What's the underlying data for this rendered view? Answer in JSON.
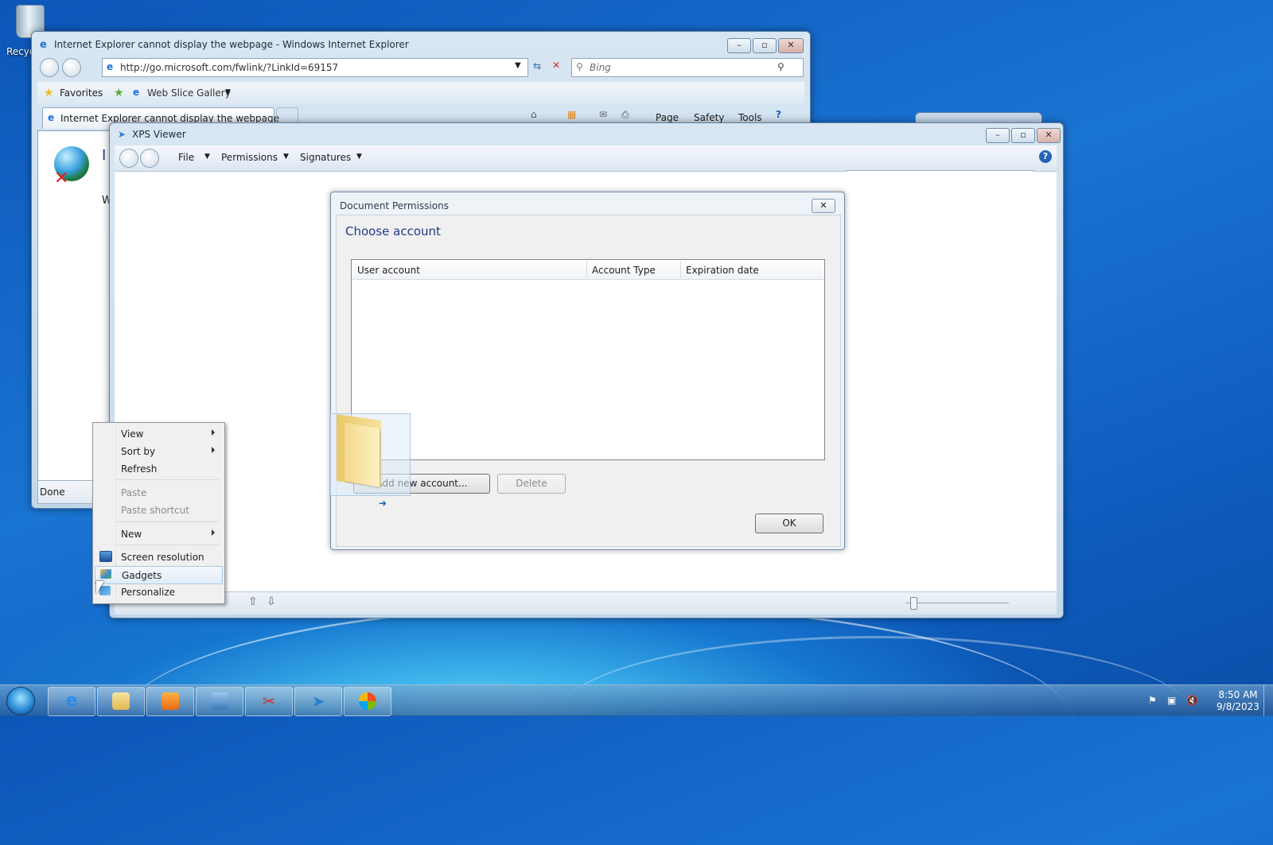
{
  "desktop": {
    "recycle_bin_label": "Recyc"
  },
  "ie_window": {
    "title": "Internet Explorer cannot display the webpage - Windows Internet Explorer",
    "address": "http://go.microsoft.com/fwlink/?LinkId=69157",
    "search_placeholder": "Bing",
    "favorites_label": "Favorites",
    "web_slice_label": "Web Slice Gallery",
    "tab_label": "Internet Explorer cannot display the webpage",
    "page_menu": "Page",
    "safety_menu": "Safety",
    "tools_menu": "Tools",
    "status_text": "Done",
    "partial_text_1": "I",
    "partial_text_2": "W"
  },
  "xps_window": {
    "title": "XPS Viewer",
    "menu_file": "File",
    "menu_permissions": "Permissions",
    "menu_signatures": "Signatures"
  },
  "dialog": {
    "title": "Document Permissions",
    "heading": "Choose account",
    "columns": [
      "User account",
      "Account Type",
      "Expiration date"
    ],
    "add_button": "Add new account...",
    "delete_button": "Delete",
    "ok_button": "OK"
  },
  "context_menu": {
    "items": [
      {
        "label": "View",
        "submenu": true,
        "enabled": true
      },
      {
        "label": "Sort by",
        "submenu": true,
        "enabled": true
      },
      {
        "label": "Refresh",
        "submenu": false,
        "enabled": true
      },
      {
        "label": "Paste",
        "submenu": false,
        "enabled": false
      },
      {
        "label": "Paste shortcut",
        "submenu": false,
        "enabled": false
      },
      {
        "label": "New",
        "submenu": true,
        "enabled": true
      },
      {
        "label": "Screen resolution",
        "submenu": false,
        "enabled": true
      },
      {
        "label": "Gadgets",
        "submenu": false,
        "enabled": true
      },
      {
        "label": "Personalize",
        "submenu": false,
        "enabled": true
      }
    ]
  },
  "taskbar": {
    "time": "8:50 AM",
    "date": "9/8/2023",
    "items": [
      "internet-explorer",
      "windows-explorer",
      "media-player",
      "control-panel",
      "snipping-tool",
      "xps-viewer",
      "windows-logo-app"
    ]
  },
  "colors": {
    "dialog_heading": "#1f3c88",
    "desktop": "#1a74d2"
  }
}
